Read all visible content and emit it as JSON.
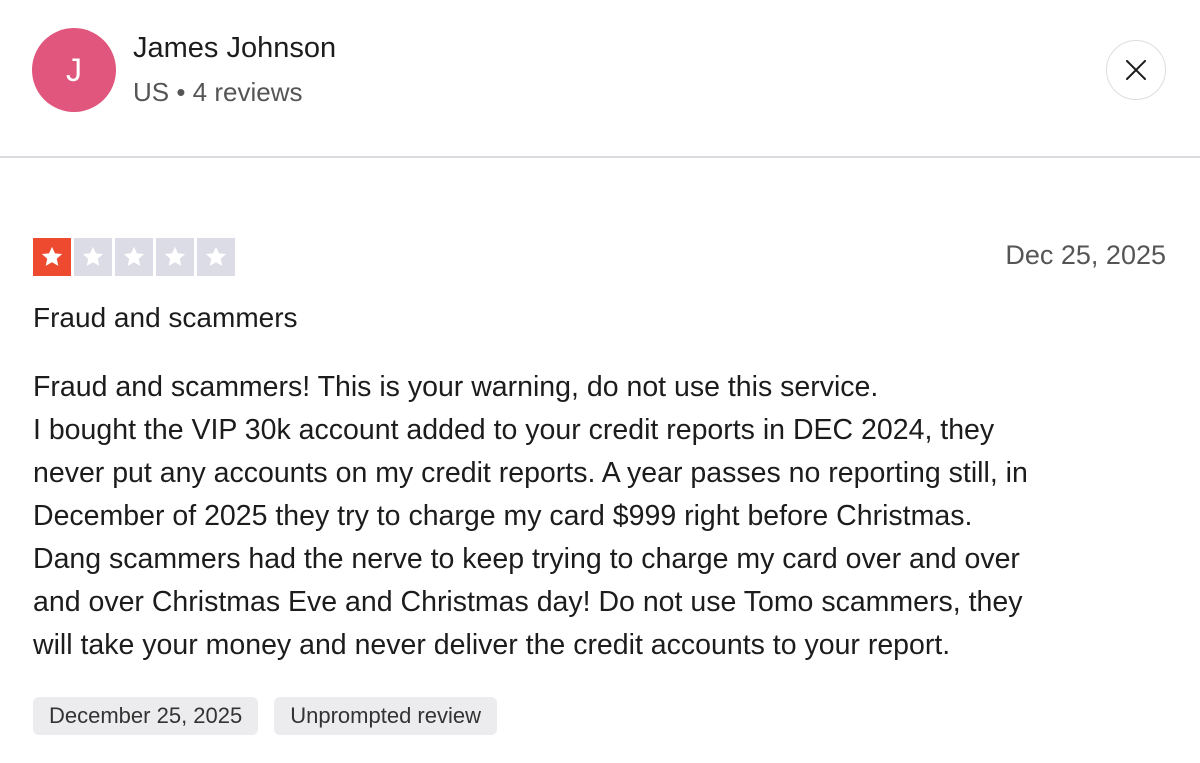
{
  "reviewer": {
    "avatar_initial": "J",
    "avatar_color": "#e0567c",
    "name": "James Johnson",
    "meta": "US • 4 reviews"
  },
  "controls": {
    "close_icon": "close-icon"
  },
  "review": {
    "rating": 1,
    "rating_max": 5,
    "star_filled_color": "#ee4a30",
    "star_empty_color": "#dcdce6",
    "date": "Dec 25, 2025",
    "title": "Fraud and scammers",
    "body_lines": [
      "Fraud and scammers! This is your warning, do not use this service.",
      "I bought the VIP 30k account added to your credit reports in DEC 2024, they",
      "never put any accounts on my credit reports. A year passes no reporting still, in",
      "December of 2025 they try to charge my card $999 right before Christmas.",
      "Dang scammers had the nerve to keep trying to charge my card over and over",
      "and over Christmas Eve and Christmas day! Do not use Tomo scammers, they",
      "will take your money and never deliver the credit accounts to your report."
    ],
    "tags": [
      "December 25, 2025",
      "Unprompted review"
    ]
  }
}
